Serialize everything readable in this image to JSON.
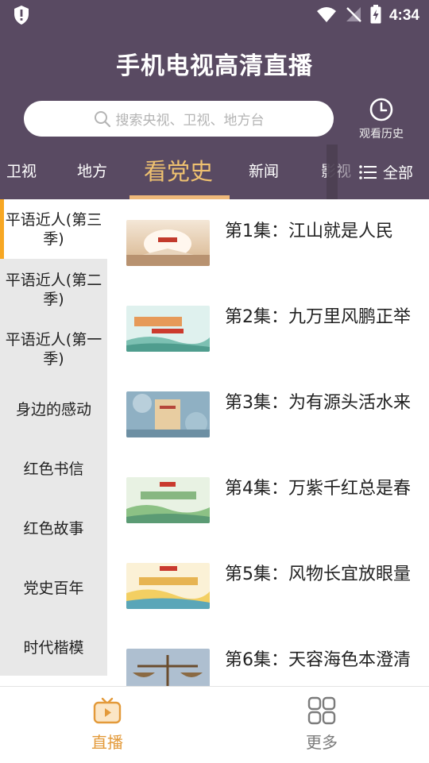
{
  "status_bar": {
    "time": "4:34"
  },
  "app_title": "手机电视高清直播",
  "search": {
    "placeholder": "搜索央视、卫视、地方台"
  },
  "history_label": "观看历史",
  "tabs": [
    {
      "label": "卫视"
    },
    {
      "label": "地方"
    },
    {
      "label": "看党史",
      "active": true
    },
    {
      "label": "新闻"
    },
    {
      "label": "影视"
    }
  ],
  "all_label": "全部",
  "sidebar": {
    "items": [
      {
        "label": "平语近人(第三季)",
        "active": true
      },
      {
        "label": "平语近人(第二季)"
      },
      {
        "label": "平语近人(第一季)"
      },
      {
        "label": "身边的感动"
      },
      {
        "label": "红色书信"
      },
      {
        "label": "红色故事"
      },
      {
        "label": "党史百年"
      },
      {
        "label": "时代楷模"
      }
    ]
  },
  "episodes": [
    {
      "title": "第1集：江山就是人民"
    },
    {
      "title": "第2集：九万里风鹏正举"
    },
    {
      "title": "第3集：为有源头活水来"
    },
    {
      "title": "第4集：万紫千红总是春"
    },
    {
      "title": "第5集：风物长宜放眼量"
    },
    {
      "title": "第6集：天容海色本澄清"
    }
  ],
  "bottom_nav": [
    {
      "label": "直播",
      "active": true
    },
    {
      "label": "更多"
    }
  ],
  "colors": {
    "header_bg": "#594a62",
    "accent_tab": "#efc170",
    "accent_nav": "#e39a3a",
    "sidebar_marker": "#f7a723"
  }
}
